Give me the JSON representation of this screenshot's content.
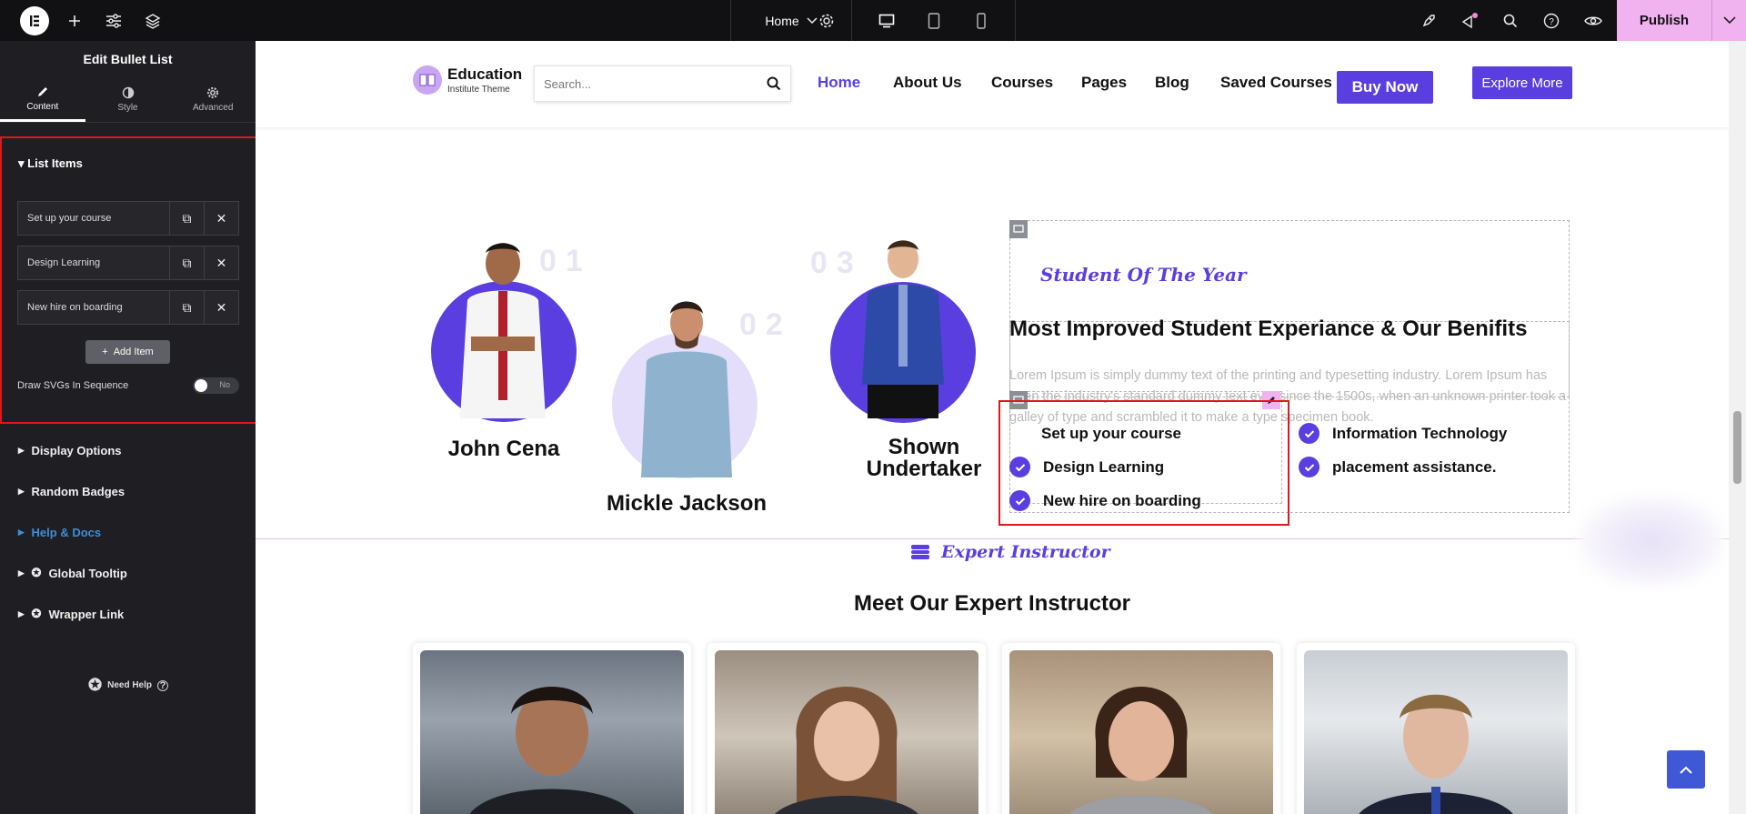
{
  "topbar": {
    "page_name": "Home",
    "publish_label": "Publish"
  },
  "panel": {
    "title": "Edit Bullet List",
    "tabs": [
      {
        "label": "Content",
        "icon": "pencil-icon"
      },
      {
        "label": "Style",
        "icon": "contrast-icon"
      },
      {
        "label": "Advanced",
        "icon": "gear-icon"
      }
    ],
    "list_items_title": "List Items",
    "items": [
      "Set up your course",
      "Design Learning",
      "New hire on boarding"
    ],
    "add_item": "Add Item",
    "draw_svgs_label": "Draw SVGs In Sequence",
    "draw_svgs_value": "No",
    "sections": [
      "Display Options",
      "Random Badges",
      "Help & Docs",
      "Global Tooltip",
      "Wrapper Link"
    ],
    "need_help": "Need Help"
  },
  "site": {
    "brand_title": "Education",
    "brand_subtitle": "Institute Theme",
    "search_placeholder": "Search...",
    "nav": [
      "Home",
      "About Us",
      "Courses",
      "Pages",
      "Blog",
      "Saved Courses"
    ],
    "buy_now": "Buy Now",
    "explore_more": "Explore More"
  },
  "students": [
    {
      "name": "John Cena",
      "num": "01"
    },
    {
      "name": "Mickle Jackson",
      "num": "02"
    },
    {
      "name": "Shown Undertaker",
      "num": "03"
    }
  ],
  "award": {
    "tagline": "Student Of The Year",
    "heading": "Most Improved Student Experiance & Our Benifits",
    "paragraph": "Lorem Ipsum is simply dummy text of the printing and typesetting industry. Lorem Ipsum has been the industry's standard dummy text ever since the 1500s, when an unknown printer took a galley of type and scrambled it to make a type specimen book.",
    "list_left": [
      "Set up your course",
      "Design Learning",
      "New hire on boarding"
    ],
    "list_right": [
      "Information Technology",
      "placement assistance."
    ]
  },
  "instructors": {
    "tagline": "Expert Instructor",
    "heading": "Meet Our Expert Instructor"
  },
  "colors": {
    "accent": "#5b3ee0",
    "topbar": "#111113",
    "panel": "#1f1f23",
    "publish": "#f0b3ef",
    "selection": "#e0161c"
  }
}
